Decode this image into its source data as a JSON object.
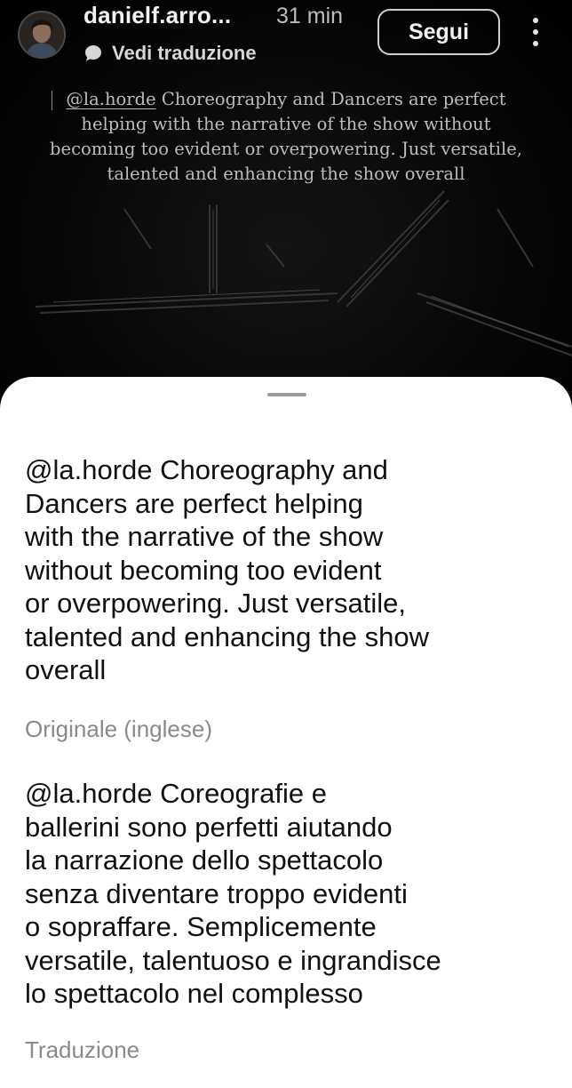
{
  "post": {
    "username": "danielf.arro...",
    "time": "31 min",
    "translate_link": "Vedi traduzione",
    "follow_label": "Segui",
    "caption_mention": "@la.horde",
    "caption_rest": " Choreography and Dancers are perfect helping with the narrative of the show without becoming too evident or overpowering. Just versatile, talented and enhancing the show overall"
  },
  "sheet": {
    "original": {
      "mention": "@la.horde",
      "text": " Choreography and\nDancers are perfect helping\nwith the narrative of the show\nwithout becoming too evident\nor overpowering. Just versatile,\ntalented and enhancing the show\noverall",
      "label": "Originale (inglese)"
    },
    "translation": {
      "mention": "@la.horde",
      "text": " Coreografie e\nballerini sono perfetti aiutando\nla narrazione dello spettacolo\nsenza diventare troppo evidenti\no sopraffare. Semplicemente\nversatile, talentuoso e ingrandisce\nlo spettacolo nel complesso",
      "label": "Traduzione"
    }
  },
  "icons": {
    "translate": "speech-bubble-icon",
    "more": "more-vertical-icon",
    "handle": "drag-handle"
  },
  "colors": {
    "story_bg": "#000000",
    "sheet_bg": "#ffffff",
    "label_gray": "#8a8a8a"
  }
}
